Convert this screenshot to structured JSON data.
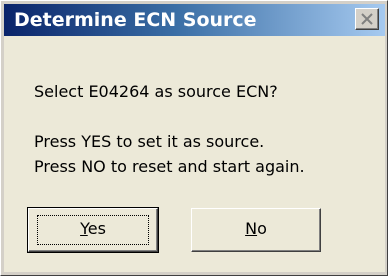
{
  "window": {
    "title": "Determine ECN Source",
    "close_icon": "close-icon"
  },
  "message": {
    "line1": "Select E04264 as source ECN?",
    "line2": "Press YES to set it as source.",
    "line3": "Press NO to reset and start again."
  },
  "buttons": {
    "yes": {
      "mnemonic": "Y",
      "rest": "es"
    },
    "no": {
      "mnemonic": "N",
      "rest": "o"
    }
  },
  "colors": {
    "title_gradient_start": "#0a246a",
    "title_gradient_end": "#a6caf0",
    "dialog_face": "#ece9d8",
    "frame_face": "#d4d0c8"
  }
}
